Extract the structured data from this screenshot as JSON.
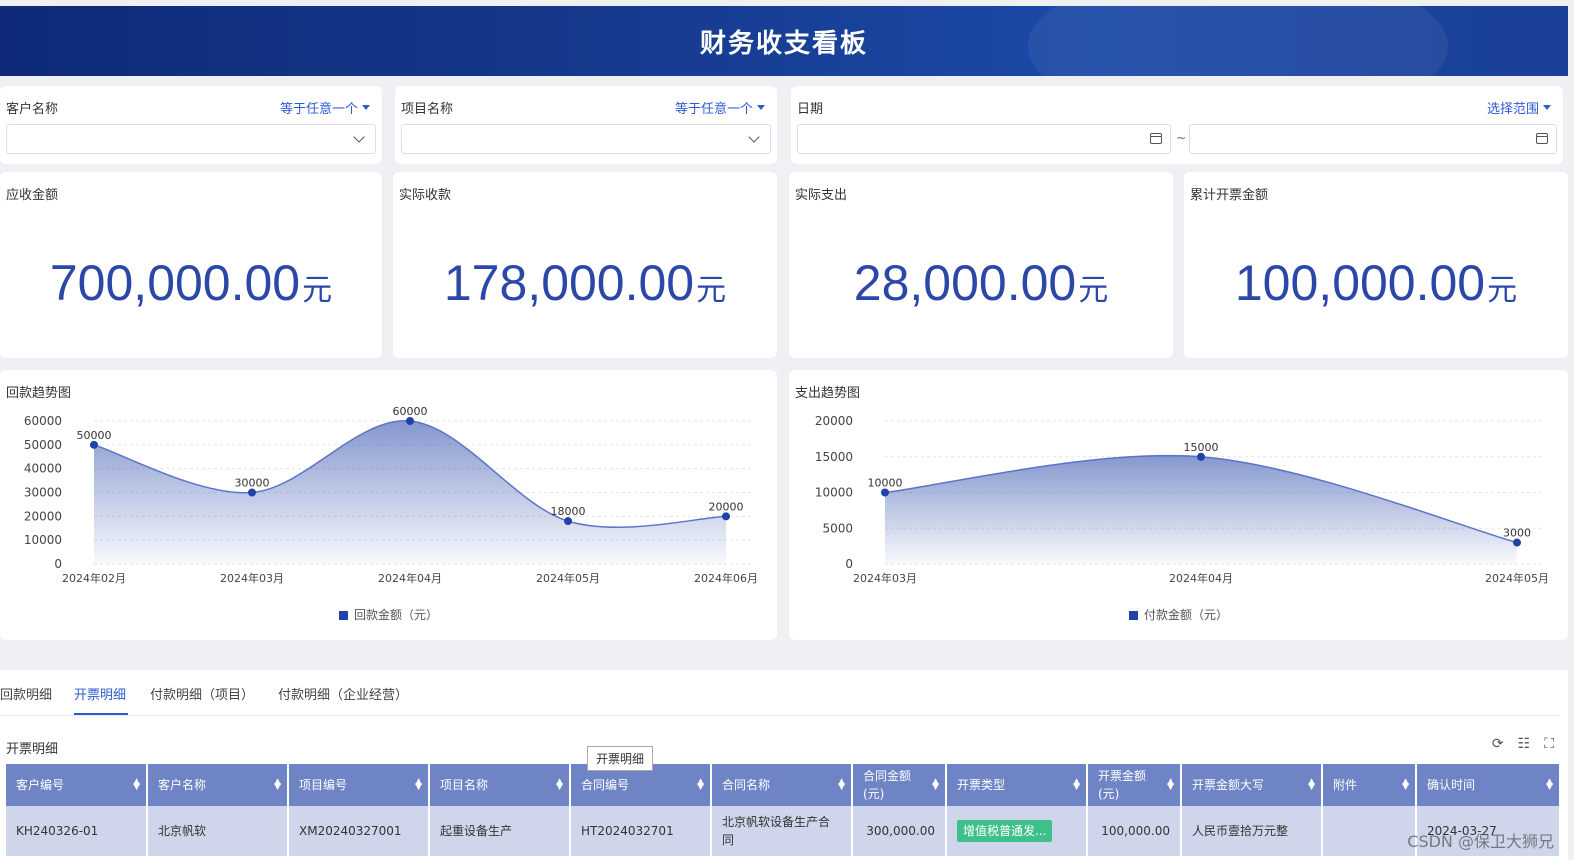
{
  "header": {
    "title": "财务收支看板"
  },
  "filters": {
    "customer": {
      "label": "客户名称",
      "operator": "等于任意一个"
    },
    "project": {
      "label": "项目名称",
      "operator": "等于任意一个"
    },
    "date": {
      "label": "日期",
      "operator": "选择范围",
      "separator": "~"
    }
  },
  "kpis": [
    {
      "label": "应收金额",
      "value": "700,000.00",
      "unit": "元"
    },
    {
      "label": "实际收款",
      "value": "178,000.00",
      "unit": "元"
    },
    {
      "label": "实际支出",
      "value": "28,000.00",
      "unit": "元"
    },
    {
      "label": "累计开票金额",
      "value": "100,000.00",
      "unit": "元"
    }
  ],
  "chart_data": [
    {
      "type": "area",
      "title": "回款趋势图",
      "categories": [
        "2024年02月",
        "2024年03月",
        "2024年04月",
        "2024年05月",
        "2024年06月"
      ],
      "series": [
        {
          "name": "回款金额（元）",
          "values": [
            50000,
            30000,
            60000,
            18000,
            20000
          ]
        }
      ],
      "ylim": [
        0,
        60000
      ],
      "yticks": [
        0,
        10000,
        20000,
        30000,
        40000,
        50000,
        60000
      ],
      "grid": true,
      "legend": "bottom-center",
      "color": "#2142a6"
    },
    {
      "type": "area",
      "title": "支出趋势图",
      "categories": [
        "2024年03月",
        "2024年04月",
        "2024年05月"
      ],
      "series": [
        {
          "name": "付款金额（元）",
          "values": [
            10000,
            15000,
            3000
          ]
        }
      ],
      "ylim": [
        0,
        20000
      ],
      "yticks": [
        0,
        5000,
        10000,
        15000,
        20000
      ],
      "grid": true,
      "legend": "bottom-center",
      "color": "#2142a6"
    }
  ],
  "tabs": [
    {
      "label": "回款明细",
      "active": false
    },
    {
      "label": "开票明细",
      "active": true
    },
    {
      "label": "付款明细（项目）",
      "active": false
    },
    {
      "label": "付款明细（企业经营）",
      "active": false
    }
  ],
  "table": {
    "title": "开票明细",
    "tooltip": "开票明细",
    "columns": [
      "客户编号",
      "客户名称",
      "项目编号",
      "项目名称",
      "合同编号",
      "合同名称",
      "合同金额\n(元)",
      "开票类型",
      "开票金额\n(元)",
      "开票金额大写",
      "附件",
      "确认时间"
    ],
    "rows": [
      [
        "KH240326-01",
        "北京帆软",
        "XM20240327001",
        "起重设备生产",
        "HT2024032701",
        "北京帆软设备生产合同",
        "300,000.00",
        "增值税普通发...",
        "100,000.00",
        "人民币壹拾万元整",
        "",
        "2024-03-27"
      ]
    ]
  },
  "tool_icons": [
    "refresh-icon",
    "tree-list-icon",
    "fullscreen-icon"
  ],
  "watermark": "CSDN @保卫大狮兄",
  "colors": {
    "accent": "#2d5bd3",
    "header_bg": "#163a8e",
    "kpi_text": "#2b47a8",
    "table_header": "#6f84c4",
    "table_row": "#cfd6ec",
    "tag_green": "#3fbf8a"
  }
}
